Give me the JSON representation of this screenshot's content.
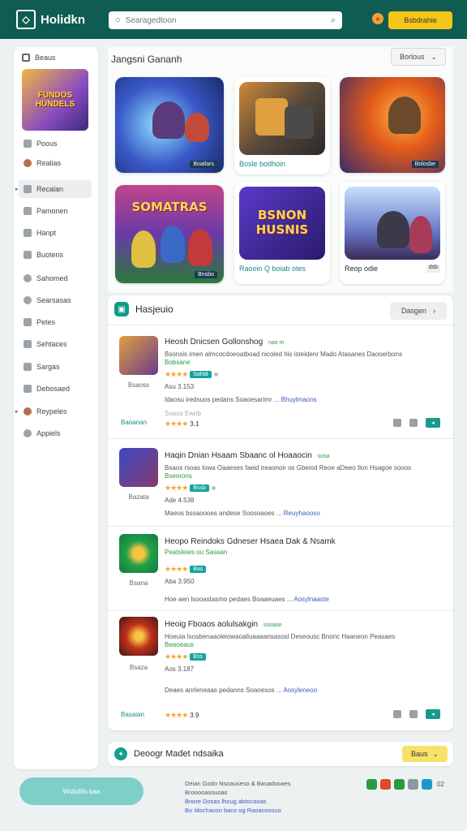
{
  "header": {
    "logo_text": "Holidkn",
    "search_placeholder": "Searagedtoon",
    "button_label": "Bsbdrahie"
  },
  "sidebar": {
    "top_label": "Beaus",
    "banner_text": "FUNDOS HUNDELS",
    "items": [
      {
        "label": "Poous",
        "active": false
      },
      {
        "label": "Realias",
        "active": false
      },
      {
        "label": "Recalan",
        "active": true
      },
      {
        "label": "Pamonen",
        "active": false
      },
      {
        "label": "Hanpt",
        "active": false
      },
      {
        "label": "Buotens",
        "active": false
      },
      {
        "label": "Sahomed",
        "active": false
      },
      {
        "label": "Searsasas",
        "active": false
      },
      {
        "label": "Petes",
        "active": false
      },
      {
        "label": "Sehtaces",
        "active": false
      },
      {
        "label": "Sargas",
        "active": false
      },
      {
        "label": "Debosaed",
        "active": false
      },
      {
        "label": "Reypeles",
        "active": false
      },
      {
        "label": "Appiels",
        "active": false
      }
    ]
  },
  "featured": {
    "title": "Jangsni Gananh",
    "select_label": "Borlous",
    "cards": [
      {
        "caption": "",
        "tag": "Boatlars"
      },
      {
        "caption": "Bosle bodhoin",
        "tag": ""
      },
      {
        "caption": "",
        "tag": "Bolosbe"
      },
      {
        "caption": "",
        "tag": "Bnsbo",
        "art_title": "SOMATRAS"
      },
      {
        "caption": "Raooin Q boiab otes",
        "tag": "",
        "art_title": "BSNON HUSNIS"
      },
      {
        "caption": "Reop odie",
        "tag": "dsb"
      }
    ]
  },
  "list": {
    "title": "Hasjeuio",
    "select_label": "Dasgen",
    "rows": [
      {
        "title": "Heosh Dnicsen Gollonshog",
        "title_sub": "nao m",
        "desc": "Bsonsis imen almcocdoeoatboad nicoled his isteidenr Mado Atasanes Daooerbons",
        "desc_green": "Bobsane",
        "rating_badge": "Sahtd",
        "meta": "Asu 3.153",
        "thumb_meta": "Bsaoss",
        "footer": "Idaosu iredsuos pedans Soaoesarimr ...",
        "footer_link": "Bhuylmaons",
        "faint": "Soaos Ewnb",
        "left_link": "Baoanan",
        "score": "3.1"
      },
      {
        "title": "Haqin Dnian Hsaam Sbaanc ol Hoaaocin",
        "title_sub": "sosa",
        "desc": "Bsaos rsoas lowa Oaaeses faeid ireaonoir os Gbeiod Reoe aDeeo Ilon Hsagoe sooos",
        "desc_green": "Bseorons",
        "rating_badge": "Bssb",
        "meta": "Ade 4.538",
        "thumb_meta": "Bazata",
        "footer": "Maeos bssaoooes andese Soosoaoes ...",
        "footer_link": "Reuyhaooso",
        "faint": "",
        "left_link": "",
        "score": ""
      },
      {
        "title": "Heopo Reindoks Gdneser Hsaea Dak & Nsamk",
        "title_sub": "",
        "desc": "Peatsleies ou Sasaan",
        "desc_green": "",
        "rating_badge": "Bas",
        "meta": "Aba 3.950",
        "thumb_meta": "Bsana",
        "footer": "Hoe aen lsooastasmo pedaes Boaaeuaes ...",
        "footer_link": "Aosylnaaste",
        "faint": "",
        "left_link": "",
        "score": ""
      },
      {
        "title": "Heoig Fboaos aolulsakgin",
        "title_sub": "sooase",
        "desc": "Hoeuia Isosbenaaoleiowaoaliuaaaansasosl Deseousc Bnonc Haaneon Peasaes",
        "desc_green": "Beaoeaus",
        "rating_badge": "Bss",
        "meta": "Aos 3.187",
        "thumb_meta": "Bsaza",
        "footer": "Deaes anrleneaas pedanns Soaoesos ...",
        "footer_link": "Aosyleneoo",
        "faint": "",
        "left_link": "Basaian",
        "score": "3.9"
      }
    ]
  },
  "bottom_bar": {
    "label": "Deoogr Madet ndsaika",
    "button_label": "Baus"
  },
  "footer": {
    "button_label": "Wobdilis baa",
    "line1": "Deian Godo Nsoauseso & Basadooaes",
    "line2": "Brooooasouoas",
    "line3": "Bnore Dosas lhoug abtocaoas",
    "line4": "Bo Idochaoso baco og Raoacoosuo",
    "icon_number": "02"
  },
  "colors": {
    "header_bg": "#0e5c52",
    "accent_yellow": "#f6c519",
    "accent_teal": "#16a3a0"
  }
}
